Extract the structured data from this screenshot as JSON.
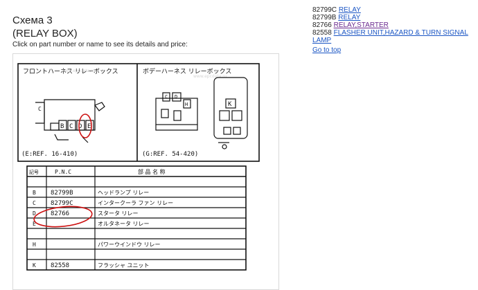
{
  "page": {
    "title_line1": "Схема 3",
    "title_line2": "(RELAY BOX)",
    "hint": "Click on part number or name to see its details and price:",
    "go_to_top": "Go to top"
  },
  "parts": [
    {
      "pnc": "82799C",
      "name": "RELAY",
      "visited": false
    },
    {
      "pnc": "82799B",
      "name": "RELAY",
      "visited": false
    },
    {
      "pnc": "82766",
      "name": "RELAY,STARTER",
      "visited": true
    },
    {
      "pnc": "82558",
      "name": "FLASHER UNIT,HAZARD & TURN SIGNAL LAMP",
      "visited": false
    }
  ],
  "diagram": {
    "left_title": "フロントハーネス リレーボックス",
    "right_title": "ボデーハーネス リレーボックス",
    "left_ref": "(E:REF. 16-410)",
    "right_ref": "(G:REF. 54-420)",
    "left_c_label": "C",
    "left_slots": [
      "B",
      "C",
      "D",
      "E"
    ],
    "right_top_labels": [
      "C",
      "D",
      "H"
    ],
    "right_k_label": "K",
    "watermark": "www.epcdata.ru",
    "table": {
      "headers": [
        "記号",
        "P.N.C",
        "部 品 名 称"
      ],
      "rows": [
        {
          "code": "",
          "pnc": "",
          "name": ""
        },
        {
          "code": "B",
          "pnc": "82799B",
          "name": "ヘッドランプ リレー"
        },
        {
          "code": "C",
          "pnc": "82799C",
          "name": "インタークーラ ファン リレー"
        },
        {
          "code": "D",
          "pnc": "82766",
          "name": "スタータ リレー"
        },
        {
          "code": "E",
          "pnc": "",
          "name": "オルタネータ リレー"
        },
        {
          "code": "",
          "pnc": "",
          "name": ""
        },
        {
          "code": "H",
          "pnc": "",
          "name": "パワーウインドウ リレー"
        },
        {
          "code": "",
          "pnc": "",
          "name": ""
        },
        {
          "code": "K",
          "pnc": "82558",
          "name": "フラッシャ ユニット"
        }
      ]
    }
  },
  "colors": {
    "link": "#1a55c4",
    "visited": "#6a2a8f",
    "annotation": "#cc1111"
  }
}
